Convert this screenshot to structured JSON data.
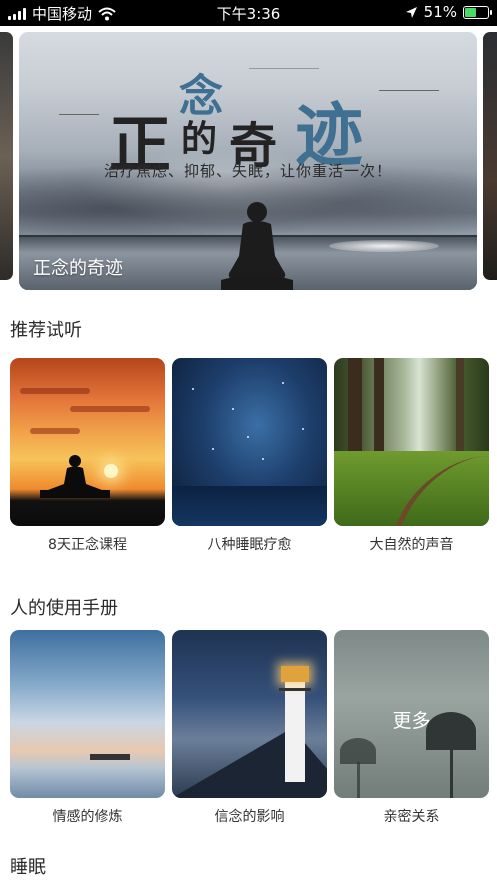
{
  "status_bar": {
    "carrier": "中国移动",
    "time": "下午3:36",
    "battery": "51%",
    "battery_level": 0.51
  },
  "banner": {
    "title_art": [
      "正",
      "念",
      "的",
      "奇",
      "迹"
    ],
    "tagline": "治疗焦虑、抑郁、失眠，让你重活一次！",
    "caption": "正念的奇迹"
  },
  "sections": [
    {
      "title": "推荐试听",
      "cards": [
        {
          "label": "8天正念课程",
          "icon": "meditation-sunset-image"
        },
        {
          "label": "八种睡眠疗愈",
          "icon": "starry-sky-image"
        },
        {
          "label": "大自然的声音",
          "icon": "forest-path-image"
        }
      ]
    },
    {
      "title": "人的使用手册",
      "cards": [
        {
          "label": "情感的修炼",
          "icon": "sky-clouds-image"
        },
        {
          "label": "信念的影响",
          "icon": "lighthouse-image"
        },
        {
          "label": "亲密关系",
          "icon": "flowers-image",
          "overlay": "更多"
        }
      ]
    },
    {
      "title": "睡眠"
    }
  ]
}
